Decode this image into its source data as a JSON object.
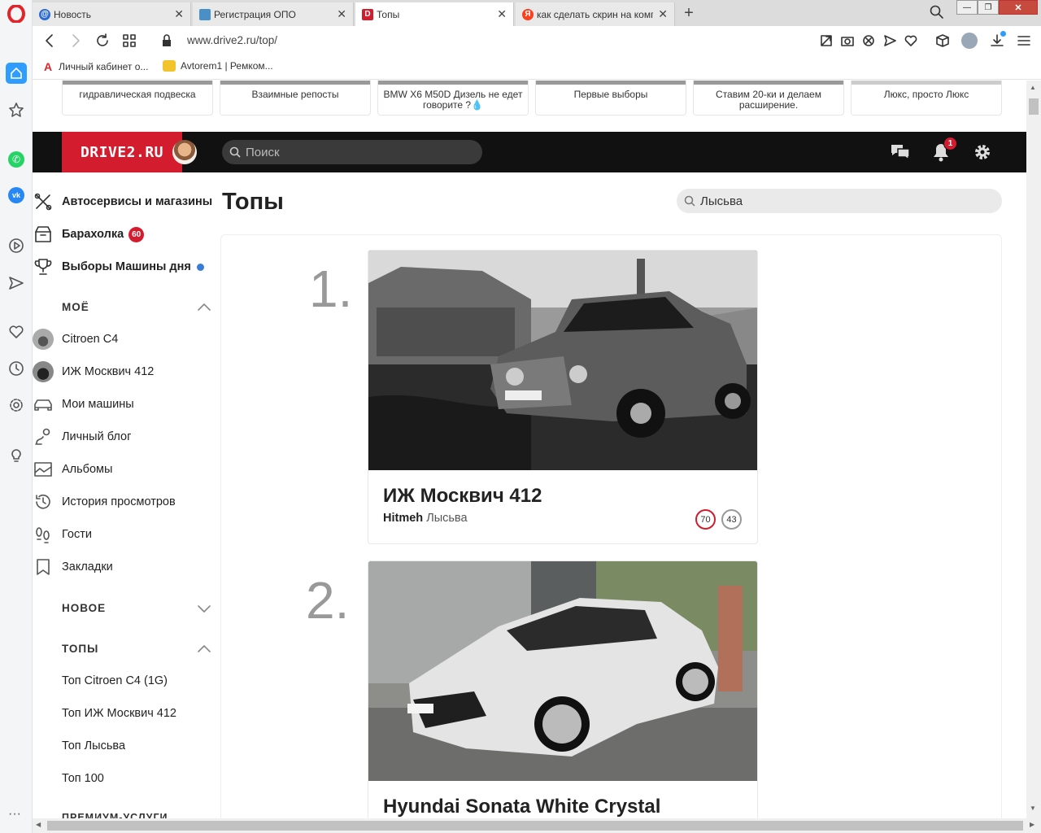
{
  "tabs": [
    {
      "title": "Новость",
      "favicon_color": "#2d6bd6"
    },
    {
      "title": "Регистрация ОПО",
      "favicon_color": "#4a90c8"
    },
    {
      "title": "Топы",
      "favicon_color": "#d31d2e",
      "favicon_letter": "D"
    },
    {
      "title": "как сделать скрин на комп",
      "favicon_color": "#fc3f1d",
      "favicon_letter": "Я"
    }
  ],
  "address": {
    "url": "www.drive2.ru/top/"
  },
  "bookmarks": [
    {
      "label": "Личный кабинет о..."
    },
    {
      "label": "Avtorem1 | Ремком..."
    }
  ],
  "strip": [
    "гидравлическая подвеска",
    "Взаимные репосты",
    "BMW X6 M50D Дизель не едет говорите ?💧",
    "Первые выборы",
    "Ставим 20-ки и делаем расширение.",
    "Люкс, просто Люкс"
  ],
  "header": {
    "logo": "DRIVE2.RU",
    "search_placeholder": "Поиск",
    "notif_count": "1"
  },
  "sidebar": {
    "top_items": [
      {
        "label": "Автосервисы и магазины"
      },
      {
        "label": "Барахолка",
        "badge": "60"
      },
      {
        "label": "Выборы Машины дня"
      }
    ],
    "moe_title": "МОЁ",
    "moe_items": [
      {
        "label": "Citroen C4",
        "icon": "car-avatar"
      },
      {
        "label": "ИЖ Москвич 412",
        "icon": "car-avatar"
      },
      {
        "label": "Мои машины",
        "icon": "car-icon"
      },
      {
        "label": "Личный блог",
        "icon": "blog-icon"
      },
      {
        "label": "Альбомы",
        "icon": "album-icon"
      },
      {
        "label": "История просмотров",
        "icon": "history-icon"
      },
      {
        "label": "Гости",
        "icon": "footprints-icon"
      },
      {
        "label": "Закладки",
        "icon": "bookmark-icon"
      }
    ],
    "novoe_title": "НОВОЕ",
    "topy_title": "ТОПЫ",
    "topy_items": [
      {
        "label": "Топ Citroen C4 (1G)"
      },
      {
        "label": "Топ ИЖ Москвич 412"
      },
      {
        "label": "Топ Лысьва"
      },
      {
        "label": "Топ 100"
      }
    ],
    "premium_title": "ПРЕМИУМ-УСЛУГИ"
  },
  "main": {
    "title": "Топы",
    "filter_value": "Лысьва",
    "entries": [
      {
        "rank": "1.",
        "car": "ИЖ Москвич 412",
        "author": "Hitmeh",
        "city": "Лысьва",
        "score_red": "70",
        "score_grey": "43"
      },
      {
        "rank": "2.",
        "car": "Hyundai Sonata White Crystal"
      }
    ]
  },
  "colors": {
    "brand": "#d31d2e",
    "header_bg": "#111111"
  }
}
